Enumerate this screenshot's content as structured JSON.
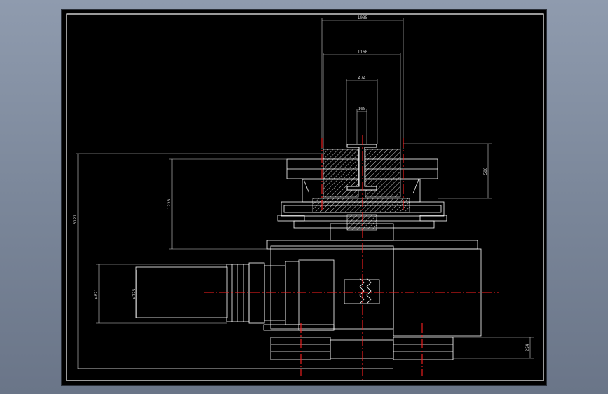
{
  "drawing": {
    "dimensions": {
      "top_outer": "1035",
      "top_mid": "1160",
      "top_inner": "474",
      "top_shaft": "108",
      "left_overall": "3121",
      "left_upper": "1238",
      "left_motor_outer": "ø821",
      "left_motor_inner": "ø725",
      "right_disc": "500",
      "right_base": "254"
    },
    "colors": {
      "background": "#000000",
      "lines": "#ffffff",
      "centerline": "#ff2020",
      "hatch": "#ffffff"
    }
  }
}
